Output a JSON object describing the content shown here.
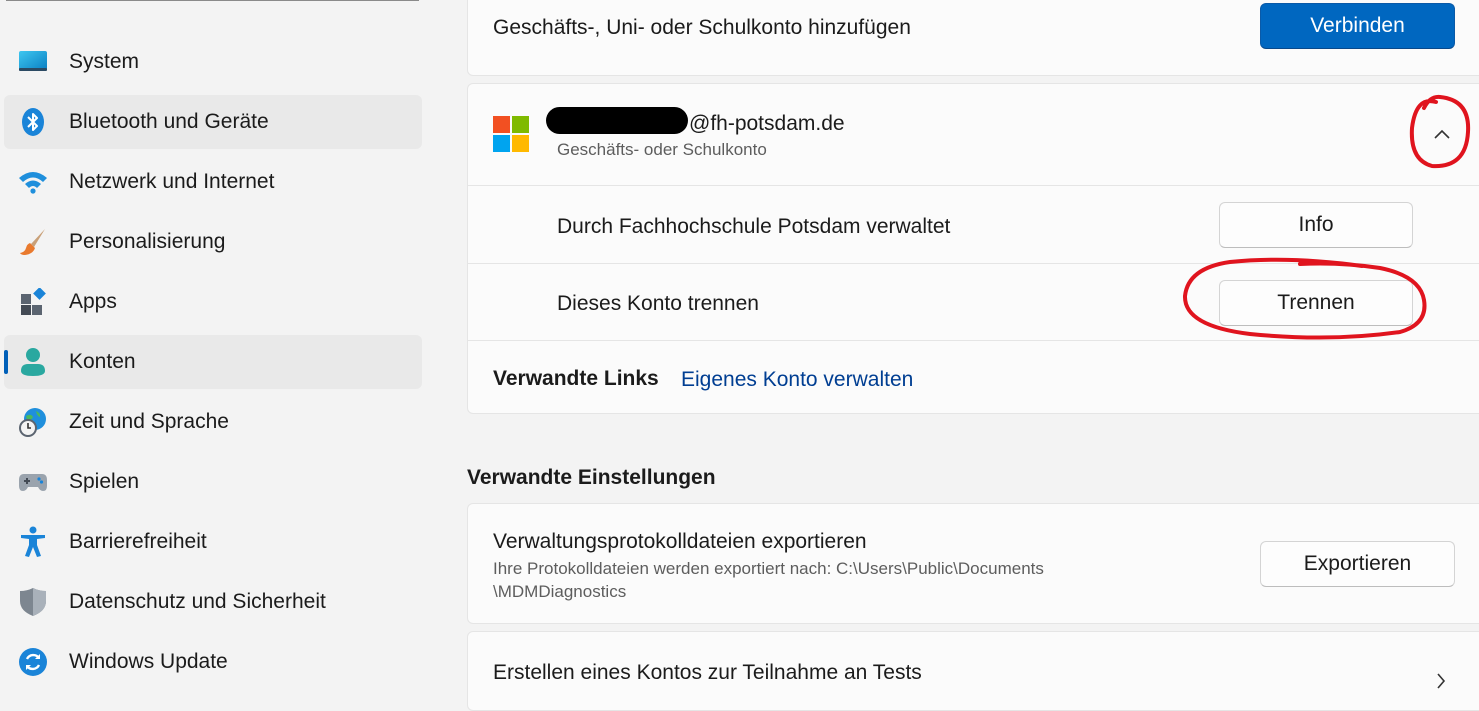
{
  "sidebar": {
    "items": [
      {
        "id": "system",
        "label": "System",
        "icon": "system-display-icon"
      },
      {
        "id": "bluetooth",
        "label": "Bluetooth und Geräte",
        "icon": "bluetooth-icon"
      },
      {
        "id": "network",
        "label": "Netzwerk und Internet",
        "icon": "wifi-icon"
      },
      {
        "id": "personalization",
        "label": "Personalisierung",
        "icon": "paintbrush-icon"
      },
      {
        "id": "apps",
        "label": "Apps",
        "icon": "apps-icon"
      },
      {
        "id": "accounts",
        "label": "Konten",
        "icon": "person-icon"
      },
      {
        "id": "time",
        "label": "Zeit und Sprache",
        "icon": "globe-clock-icon"
      },
      {
        "id": "gaming",
        "label": "Spielen",
        "icon": "gamepad-icon"
      },
      {
        "id": "accessibility",
        "label": "Barrierefreiheit",
        "icon": "accessibility-icon"
      },
      {
        "id": "privacy",
        "label": "Datenschutz und Sicherheit",
        "icon": "shield-icon"
      },
      {
        "id": "update",
        "label": "Windows Update",
        "icon": "sync-icon"
      }
    ],
    "selected": "accounts",
    "hovered": "bluetooth"
  },
  "connect_card": {
    "label": "Geschäfts-, Uni- oder Schulkonto hinzufügen",
    "button": "Verbinden"
  },
  "account_card": {
    "email_visible": "@fh-potsdam.de",
    "type": "Geschäfts- oder Schulkonto",
    "managed_label": "Durch Fachhochschule Potsdam verwaltet",
    "info_button": "Info",
    "disconnect_label": "Dieses Konto trennen",
    "disconnect_button": "Trennen",
    "related_links_label": "Verwandte Links",
    "related_link": "Eigenes Konto verwalten"
  },
  "related_settings": {
    "title": "Verwandte Einstellungen",
    "export_title": "Verwaltungsprotokolldateien exportieren",
    "export_desc_line1": "Ihre Protokolldateien werden exportiert nach: C:\\Users\\Public\\Documents",
    "export_desc_line2": "\\MDMDiagnostics",
    "export_button": "Exportieren",
    "test_account": "Erstellen eines Kontos zur Teilnahme an Tests"
  },
  "colors": {
    "accent": "#0067c0",
    "link": "#003e92",
    "annotation": "#e0141e",
    "ms_red": "#f25022",
    "ms_green": "#7fba00",
    "ms_blue": "#00a4ef",
    "ms_yellow": "#ffb900"
  }
}
